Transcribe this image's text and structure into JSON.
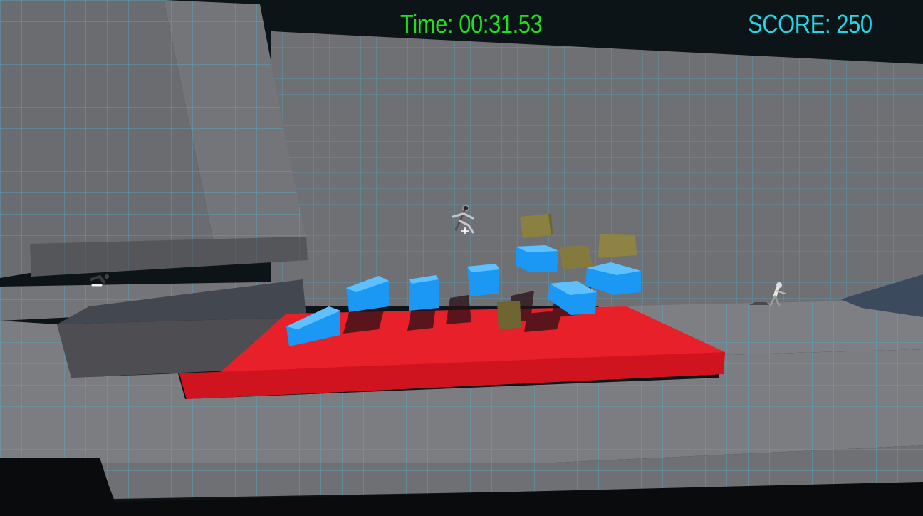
{
  "hud": {
    "time_label": "Time: 00:31.53",
    "score_label": "SCORE: 250",
    "time_color": "#1ee01e",
    "score_color": "#21d7e6"
  },
  "scene": {
    "grid_color": "#49b6d9",
    "colors": {
      "sky": "#0c1418",
      "wall": "#6b6d71",
      "floor": "#7b7d80",
      "ledge_top": "#55565a",
      "ledge_front": "#4a4a4e",
      "red_platform": "#e8202a",
      "blue_block": "#1a98f4",
      "olive_block": "#8a8040"
    },
    "objects": [
      "player-character",
      "enemy-runner",
      "enemy-crouching",
      "crosshair"
    ]
  }
}
